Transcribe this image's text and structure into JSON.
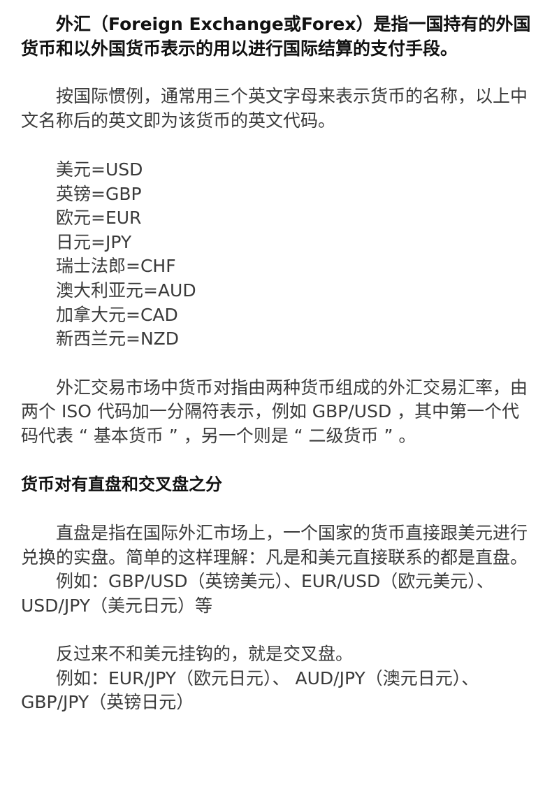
{
  "intro": "外汇（Foreign Exchange或Forex）是指一国持有的外国货币和以外国货币表示的用以进行国际结算的支付手段。",
  "convention": "按国际惯例，通常用三个英文字母来表示货币的名称，以上中文名称后的英文即为该货币的英文代码。",
  "currencies": [
    "美元=USD",
    "英镑=GBP",
    "欧元=EUR",
    "日元=JPY",
    "瑞士法郎=CHF",
    "澳大利亚元=AUD",
    "加拿大元=CAD",
    "新西兰元=NZD"
  ],
  "pair_explanation": "外汇交易市场中货币对指由两种货币组成的外汇交易汇率，由两个 ISO 代码加一分隔符表示，例如 GBP/USD ，其中第一个代码代表 “ 基本货币 ” ，另一个则是 “ 二级货币 ” 。",
  "section_heading": "货币对有直盘和交叉盘之分",
  "direct_definition": "直盘是指在国际外汇市场上，一个国家的货币直接跟美元进行兑换的实盘。简单的这样理解：凡是和美元直接联系的都是直盘。",
  "direct_example": "例如：GBP/USD（英镑美元）、EUR/USD（欧元美元）、USD/JPY（美元日元）等",
  "cross_definition": "反过来不和美元挂钩的，就是交叉盘。",
  "cross_example": "例如：EUR/JPY（欧元日元）、 AUD/JPY（澳元日元）、GBP/JPY（英镑日元）"
}
